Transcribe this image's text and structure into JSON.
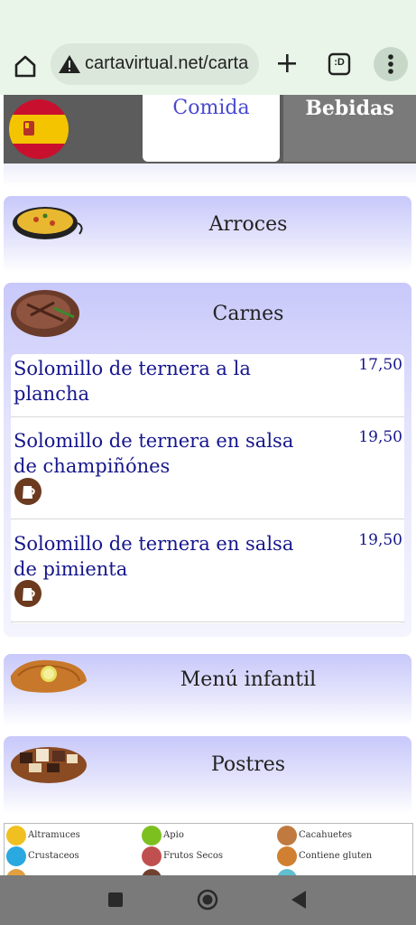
{
  "browser": {
    "url": "cartavirtual.net/carta",
    "tab_count": ":D"
  },
  "tabs": {
    "comida": "Comida",
    "bebidas": "Bebidas"
  },
  "categories": {
    "arroces": "Arroces",
    "carnes": "Carnes",
    "infantil": "Menú infantil",
    "postres": "Postres"
  },
  "carnes_items": [
    {
      "name": "Solomillo de ternera a la plancha",
      "price": "17,50"
    },
    {
      "name": "Solomillo de ternera en salsa de champiñónes",
      "price": "19,50"
    },
    {
      "name": "Solomillo de ternera en salsa de pimienta",
      "price": "19,50"
    }
  ],
  "allergens": [
    {
      "label": "Altramuces",
      "color": "#f0c020"
    },
    {
      "label": "Apio",
      "color": "#7cc020"
    },
    {
      "label": "Cacahuetes",
      "color": "#c07a40"
    },
    {
      "label": "Crustaceos",
      "color": "#2aa8e0"
    },
    {
      "label": "Frutos Secos",
      "color": "#c05050"
    },
    {
      "label": "Contiene gluten",
      "color": "#d08030"
    }
  ],
  "colors": {
    "accent": "#16168c",
    "tab_active": "#4a4ad0",
    "header_bg": "#5c5c5c"
  }
}
